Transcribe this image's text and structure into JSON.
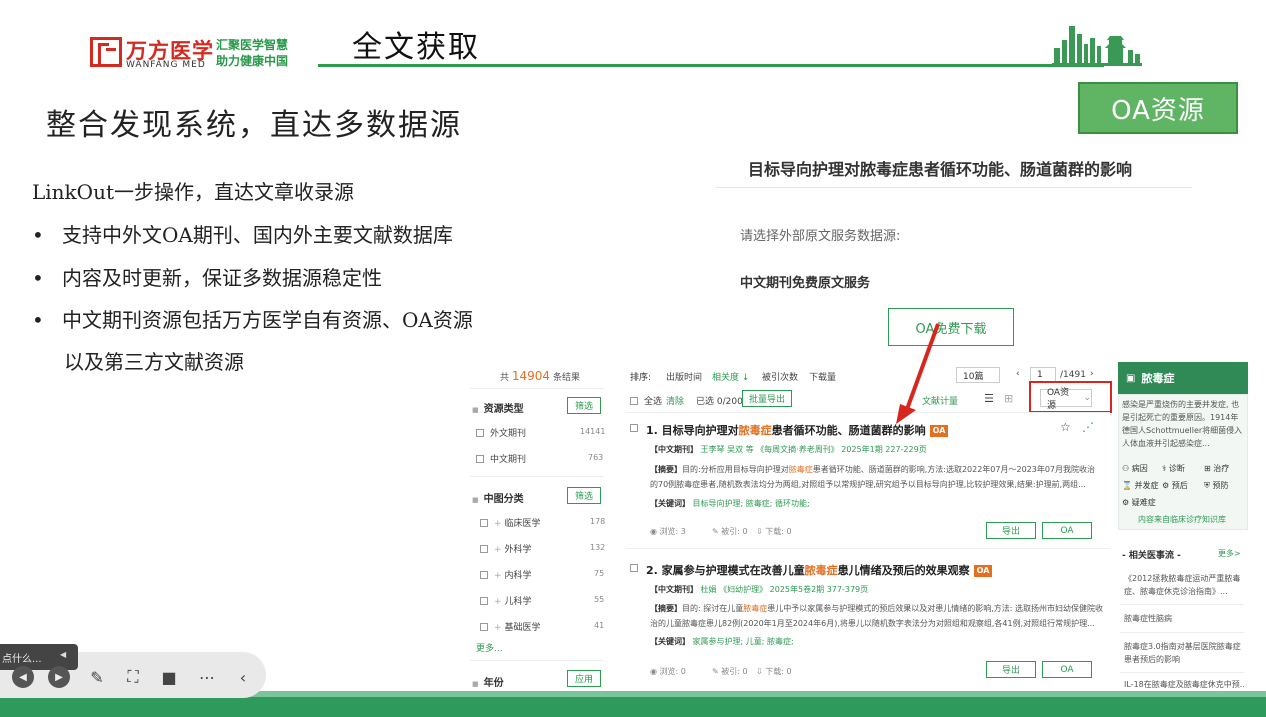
{
  "header": {
    "logo_cn": "万方医学",
    "logo_en": "WANFANG MED",
    "slogan_line1": "汇聚医学智慧",
    "slogan_line2": "助力健康中国",
    "title": "全文获取"
  },
  "slide": {
    "heading": "整合发现系统，直达多数据源",
    "badge": "OA资源",
    "linkout": "LinkOut一步操作，直达文章收录源",
    "bullets": [
      "支持中外文OA期刊、国内外主要文献数据库",
      "内容及时更新，保证多数据源稳定性",
      "中文期刊资源包括万方医学自有资源、OA资源"
    ],
    "bullet_cont": "以及第三方文献资源",
    "bullet_dot": "•"
  },
  "article_card": {
    "title": "目标导向护理对脓毒症患者循环功能、肠道菌群的影响",
    "ext_label": "请选择外部原文服务数据源:",
    "cn_service": "中文期刊免费原文服务",
    "oa_download": "OA免费下载"
  },
  "facets": {
    "count_prefix": "共",
    "count": "14904",
    "count_suffix": "条结果",
    "resource_type": {
      "title": "资源类型",
      "filter": "筛选",
      "items": [
        {
          "label": "外文期刊",
          "count": "14141"
        },
        {
          "label": "中文期刊",
          "count": "763"
        }
      ]
    },
    "clc": {
      "title": "中图分类",
      "filter": "筛选",
      "items": [
        {
          "label": "临床医学",
          "count": "178"
        },
        {
          "label": "外科学",
          "count": "132"
        },
        {
          "label": "内科学",
          "count": "75"
        },
        {
          "label": "儿科学",
          "count": "55"
        },
        {
          "label": "基础医学",
          "count": "41"
        }
      ],
      "more": "更多..."
    },
    "year": {
      "title": "年份",
      "apply": "应用"
    }
  },
  "results": {
    "sort_label": "排序:",
    "sort_items": [
      "出版时间",
      "相关度 ↓",
      "被引次数",
      "下载量"
    ],
    "page_size": "10篇",
    "page_current": "1",
    "page_total": "/1491",
    "select_all": "全选",
    "clear": "清除",
    "selected": "已选",
    "selected_count": "0/200",
    "batch_export": "批量导出",
    "doc_metrics": "文献计量",
    "oa_filter": "OA资源",
    "rows": [
      {
        "title_pre": "1. 目标导向护理对",
        "title_hl": "脓毒症",
        "title_post": "患者循环功能、肠道菌群的影响",
        "tag": "OA",
        "source_label": "【中文期刊】",
        "authors": "王李琴 吴双 等",
        "journal": "《每周文摘·养老周刊》",
        "issue": "2025年1期 227-229页",
        "abstract_label": "【摘要】",
        "abstract_1": "目的:分析应用目标导向护理对",
        "abstract_hl": "脓毒症",
        "abstract_2": "患者循环功能、肠道菌群的影响,方法:选取2022年07月～2023年07月我院收治",
        "abstract_3": "的70例脓毒症患者,随机数表法均分为两组,对照组予以常规护理,研究组予以目标导向护理,比较护理效果,结果:护理前,两组...",
        "keywords_label": "【关键词】",
        "keywords": "目标导向护理;  脓毒症;  循环功能;",
        "views": "浏览: 3",
        "cites": "被引: 0",
        "downloads": "下载: 0",
        "export": "导出",
        "oa": "OA"
      },
      {
        "title_pre": "2. 家属参与护理模式在改善儿童",
        "title_hl": "脓毒症",
        "title_post": "患儿情绪及预后的效果观察",
        "tag": "OA",
        "source_label": "【中文期刊】",
        "authors": "杜娟",
        "journal": "《妇幼护理》",
        "issue": "2025年5卷2期 377-379页",
        "abstract_label": "【摘要】",
        "abstract_1": "目的: 探讨在儿童",
        "abstract_hl": "脓毒症",
        "abstract_2": "患儿中予以家属参与护理模式的预后效果以及对患儿情绪的影响,方法: 选取扬州市妇幼保健院收",
        "abstract_3": "治的儿童脓毒症患儿82例(2020年1月至2024年6月),将患儿以随机数字表法分为对照组和观察组,各41例,对照组行常规护理...",
        "keywords_label": "【关键词】",
        "keywords": "家属参与护理;  儿童;  脓毒症;",
        "views": "浏览: 0",
        "cites": "被引: 0",
        "downloads": "下载: 0",
        "export": "导出",
        "oa": "OA"
      }
    ]
  },
  "side": {
    "title": "脓毒症",
    "desc": "感染是严重烧伤的主要并发症, 也是引起死亡的重要原因。1914年德国人Schottmueller将细菌侵入人体血液并引起感染症...",
    "cats": [
      "病因",
      "诊断",
      "治疗",
      "并发症",
      "预后",
      "预防",
      "疑难症"
    ],
    "link": "内容来自临床诊疗知识库",
    "news_title": "- 相关医事流 -",
    "news_more": "更多>",
    "news": [
      "《2012拯救脓毒症运动严重脓毒症、脓毒症休克诊治指南》...",
      "脓毒症性脑病",
      "脓毒症3.0指南对基层医院脓毒症患者预后的影响",
      "IL-18在脓毒症及脓毒症休克中预..."
    ]
  },
  "player": {
    "tip": "点什么...",
    "tip_arrow": "◀"
  }
}
